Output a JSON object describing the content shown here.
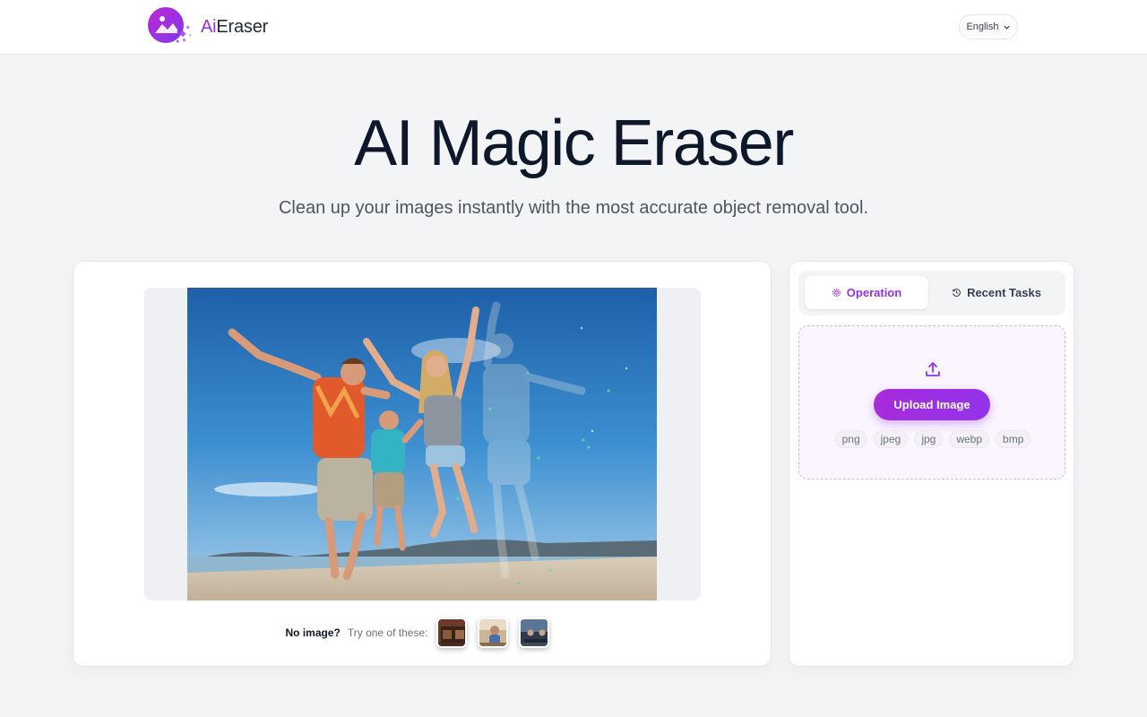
{
  "header": {
    "logo_ai": "Ai",
    "logo_rest": "Eraser",
    "language": "English"
  },
  "hero": {
    "title": "AI Magic Eraser",
    "subtitle": "Clean up your images instantly with the most accurate object removal tool."
  },
  "preview": {
    "no_image_label": "No image?",
    "try_label": "Try one of these:",
    "samples": [
      "sample-room-icon",
      "sample-person-icon",
      "sample-office-icon"
    ]
  },
  "panel": {
    "tabs": [
      {
        "label": "Operation",
        "icon": "gear-icon",
        "active": true
      },
      {
        "label": "Recent Tasks",
        "icon": "history-icon",
        "active": false
      }
    ],
    "upload_label": "Upload Image",
    "formats": [
      "png",
      "jpeg",
      "jpg",
      "webp",
      "bmp"
    ]
  },
  "colors": {
    "accent": "#9333ea",
    "background": "#f3f4f6",
    "title": "#0f172a"
  }
}
